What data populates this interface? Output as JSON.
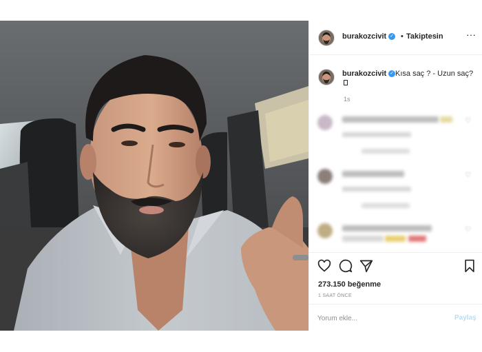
{
  "post": {
    "username": "burakozcivit",
    "verified_icon": "verified-badge-icon",
    "separator": "•",
    "follow_status": "Takiptesin",
    "more_icon": "more-options-icon",
    "more_glyph": "···"
  },
  "caption": {
    "username": "burakozcivit",
    "text": "Kısa saç ? - Uzun saç?",
    "time": "1s"
  },
  "actions": {
    "icons": [
      "heart-icon",
      "comment-icon",
      "share-icon",
      "bookmark-icon"
    ],
    "likes": "273.150 beğenme",
    "time_ago": "1 SAAT ÖNCE"
  },
  "comment_box": {
    "placeholder": "Yorum ekle...",
    "submit_label": "Paylaş"
  },
  "colors": {
    "accent": "#3897f0",
    "share_disabled": "#b2dffc",
    "muted_text": "#8e8e8e",
    "divider": "#efefef"
  }
}
